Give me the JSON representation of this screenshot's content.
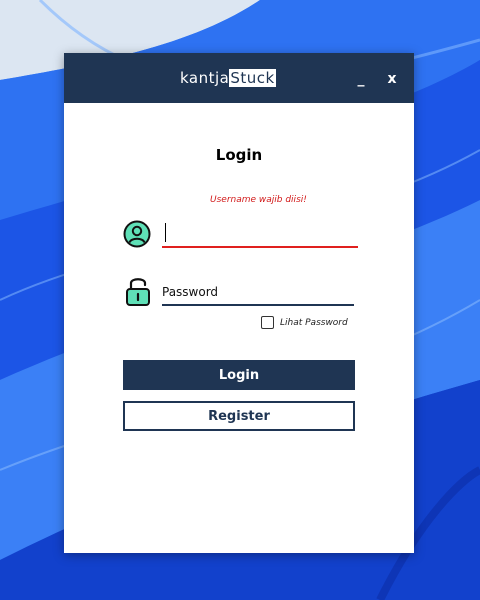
{
  "window": {
    "logo_left": "kantja",
    "logo_right": "Stuck",
    "minimize_label": "_",
    "close_label": "x"
  },
  "login": {
    "heading": "Login",
    "error": "Username wajib diisi!",
    "username_value": "",
    "password_placeholder": "Password",
    "show_password_label": "Lihat Password",
    "show_password_checked": false,
    "login_button": "Login",
    "register_button": "Register"
  },
  "colors": {
    "primary": "#1f3553",
    "error": "#d21a1a",
    "icon_fill": "#5fe0b7"
  },
  "icons": [
    "user-icon",
    "lock-icon"
  ]
}
